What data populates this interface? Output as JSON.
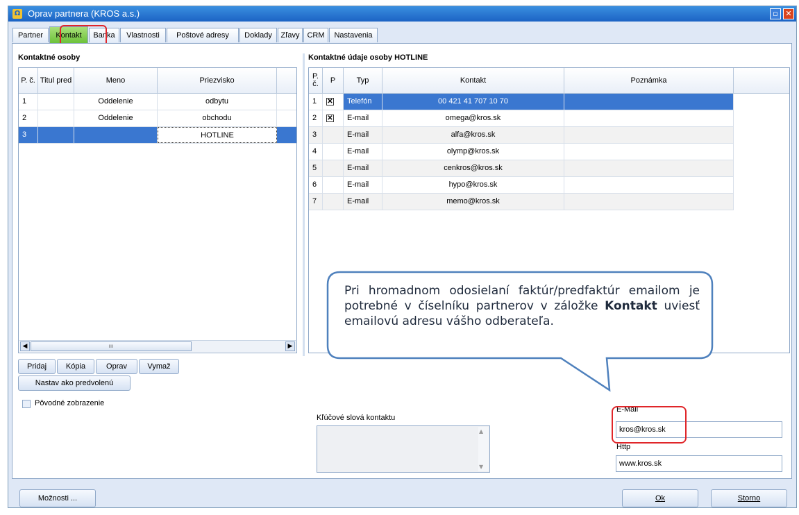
{
  "window": {
    "title": "Oprav partnera (KROS a.s.)"
  },
  "tabs": [
    "Partner",
    "Kontakt",
    "Banka",
    "Vlastnosti",
    "Poštové adresy",
    "Doklady",
    "Zľavy",
    "CRM",
    "Nastavenia"
  ],
  "active_tab": "Kontakt",
  "left": {
    "title": "Kontaktné osoby",
    "headers": [
      "P. č.",
      "Titul pred",
      "Meno",
      "Priezvisko"
    ],
    "rows": [
      {
        "n": "1",
        "titul": "",
        "meno": "Oddelenie",
        "priezvisko": "odbytu"
      },
      {
        "n": "2",
        "titul": "",
        "meno": "Oddelenie",
        "priezvisko": "obchodu"
      },
      {
        "n": "3",
        "titul": "",
        "meno": "",
        "priezvisko": "HOTLINE"
      }
    ],
    "selected_row": 3,
    "buttons": {
      "add": "Pridaj",
      "copy": "Kópia",
      "edit": "Oprav",
      "delete": "Vymaž",
      "default": "Nastav ako predvolenú"
    },
    "original_view": "Pôvodné zobrazenie"
  },
  "right": {
    "title": "Kontaktné údaje osoby HOTLINE",
    "headers": [
      "P. č.",
      "P",
      "Typ",
      "Kontakt",
      "Poznámka"
    ],
    "rows": [
      {
        "n": "1",
        "p": true,
        "typ": "Telefón",
        "kontakt": "00 421 41 707 10 70",
        "poznamka": ""
      },
      {
        "n": "2",
        "p": true,
        "typ": "E-mail",
        "kontakt": "omega@kros.sk",
        "poznamka": ""
      },
      {
        "n": "3",
        "p": false,
        "typ": "E-mail",
        "kontakt": "alfa@kros.sk",
        "poznamka": ""
      },
      {
        "n": "4",
        "p": false,
        "typ": "E-mail",
        "kontakt": "olymp@kros.sk",
        "poznamka": ""
      },
      {
        "n": "5",
        "p": false,
        "typ": "E-mail",
        "kontakt": "cenkros@kros.sk",
        "poznamka": ""
      },
      {
        "n": "6",
        "p": false,
        "typ": "E-mail",
        "kontakt": "hypo@kros.sk",
        "poznamka": ""
      },
      {
        "n": "7",
        "p": false,
        "typ": "E-mail",
        "kontakt": "memo@kros.sk",
        "poznamka": ""
      }
    ],
    "selected_row": 1
  },
  "callout": {
    "part1": "Pri hromadnom odosielaní faktúr/predfaktúr emailom je potrebné v číselníku partnerov v záložke ",
    "bold": "Kontakt",
    "part2": " uviesť emailovú adresu vášho odberateľa."
  },
  "keywords_label": "Kľúčové slová kontaktu",
  "email": {
    "label": "E-Mail",
    "value": "kros@kros.sk"
  },
  "http": {
    "label": "Http",
    "value": "www.kros.sk"
  },
  "footer": {
    "options": "Možnosti ...",
    "ok": "Ok",
    "cancel": "Storno"
  },
  "colors": {
    "accent_red": "#e0262a",
    "selection": "#3a77d0",
    "active_tab": "#6cc23a"
  }
}
